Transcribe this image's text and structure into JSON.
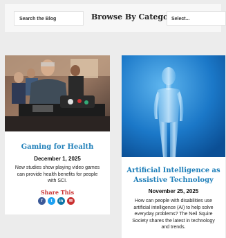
{
  "filter": {
    "search_label": "Search the Blog",
    "browse_title": "Browse By Category",
    "select_value": "Select..."
  },
  "posts": [
    {
      "title": "Gaming for Health",
      "date": "December 1, 2025",
      "description": "New studies show playing video games can provide health benefits for people with SCI.",
      "share_label": "Share This",
      "share_buttons": [
        {
          "icon": "facebook-icon",
          "glyph": "f",
          "color": "#3b5998"
        },
        {
          "icon": "twitter-icon",
          "glyph": "t",
          "color": "#1da1f2"
        },
        {
          "icon": "linkedin-icon",
          "glyph": "in",
          "color": "#0e76a8"
        },
        {
          "icon": "email-icon",
          "glyph": "✉",
          "color": "#c93030"
        }
      ]
    },
    {
      "title": "Artificial Intelligence as Assistive Technology",
      "date": "November 25, 2025",
      "description": "How can people with disabilities use artificial intelligence (AI) to help solve everyday problems? The Neil Squire Society shares the latest in technology and trends."
    }
  ],
  "colors": {
    "title": "#1f7fb9",
    "share": "#c93030"
  }
}
